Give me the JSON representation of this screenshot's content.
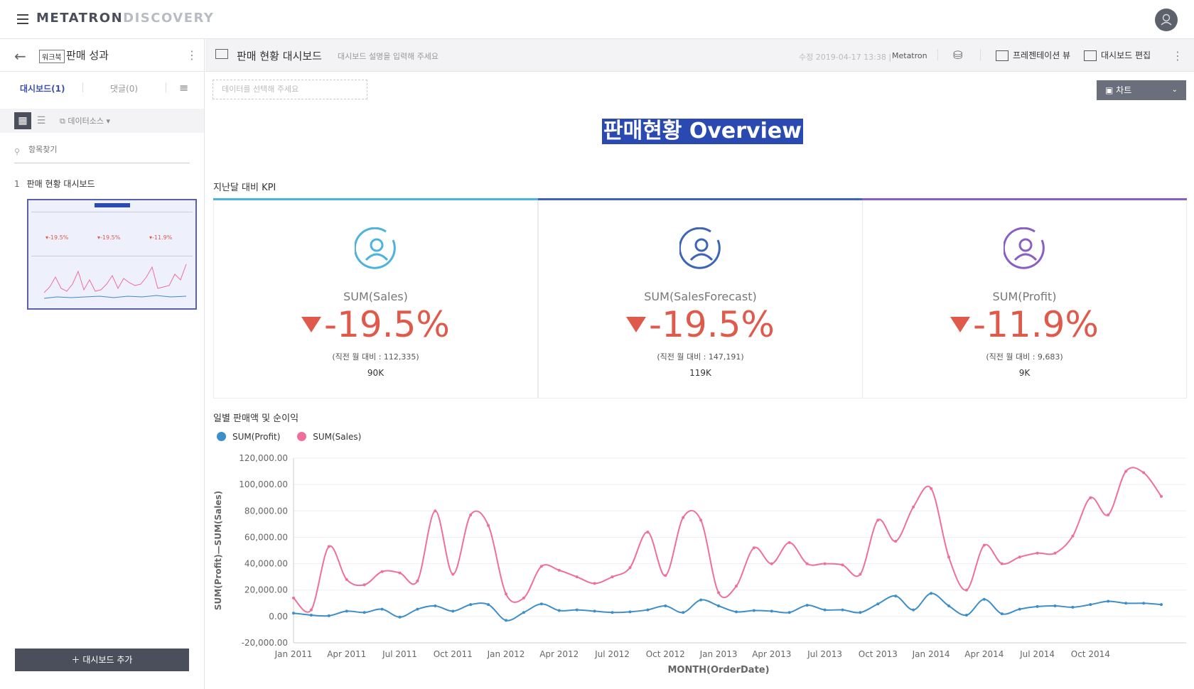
{
  "app": {
    "brand_primary": "METATRON",
    "brand_secondary": "DISCOVERY"
  },
  "sidebar": {
    "workbook_badge": "워크북",
    "workbook_title": "판매 성과",
    "tab_dashboards": "대시보드(1)",
    "tab_comments": "댓글(0)",
    "datasource_label": "데이터소스",
    "search_placeholder": "항목찾기",
    "items": [
      {
        "index": "1",
        "label": "판매 현황 대시보드"
      }
    ],
    "add_button": "대시보드 추가"
  },
  "header": {
    "dashboard_title": "판매 현황 대시보드",
    "description_placeholder": "대시보드 설명을 입력해 주세요",
    "modified": "수정 2019-04-17 13:38 |",
    "modified_by": "Metatron",
    "presentation_label": "프레젠테이션 뷰",
    "edit_label": "대시보드 편집"
  },
  "toolbar": {
    "data_select_placeholder": "데이터를 선택해 주세요",
    "chart_button": "차트"
  },
  "page_title": "판매현황 Overview",
  "kpi_section_label": "지난달 대비 KPI",
  "kpis": [
    {
      "name": "SUM(Sales)",
      "value": "-19.5%",
      "sub": "(직전 월 대비 : 112,335)",
      "abs": "90K",
      "color": "#4db3dc"
    },
    {
      "name": "SUM(SalesForecast)",
      "value": "-19.5%",
      "sub": "(직전 월 대비 : 147,191)",
      "abs": "119K",
      "color": "#3d64b8"
    },
    {
      "name": "SUM(Profit)",
      "value": "-11.9%",
      "sub": "(직전 월 대비 : 9,683)",
      "abs": "9K",
      "color": "#8a5fc4"
    }
  ],
  "chart_section_label": "일별 판매액 및 순이익",
  "chart_data": {
    "type": "line",
    "xlabel": "MONTH(OrderDate)",
    "ylabel": "SUM(Profit)—SUM(Sales)",
    "ylim": [
      -20000,
      120000
    ],
    "yticks": [
      "120,000.00",
      "100,000.00",
      "80,000.00",
      "60,000.00",
      "40,000.00",
      "20,000.00",
      "0.00",
      "-20,000.00"
    ],
    "xticks": [
      "Jan 2011",
      "Apr 2011",
      "Jul 2011",
      "Oct 2011",
      "Jan 2012",
      "Apr 2012",
      "Jul 2012",
      "Oct 2012",
      "Jan 2013",
      "Apr 2013",
      "Jul 2013",
      "Oct 2013",
      "Jan 2014",
      "Apr 2014",
      "Jul 2014",
      "Oct 2014"
    ],
    "legend": "top-left",
    "series": [
      {
        "name": "SUM(Profit)",
        "color": "#3d8ec9",
        "values": [
          2500,
          1000,
          500,
          4000,
          3000,
          5500,
          -500,
          5500,
          8000,
          4000,
          9000,
          9000,
          -3000,
          3000,
          9500,
          4500,
          5000,
          4000,
          3000,
          3500,
          5000,
          8000,
          3000,
          12500,
          8000,
          3500,
          4500,
          4000,
          3000,
          8500,
          5000,
          5000,
          3000,
          9500,
          15500,
          5000,
          17500,
          8000,
          1000,
          13000,
          2000,
          5500,
          7500,
          8000,
          7000,
          9000,
          11500,
          10000,
          10000,
          9000
        ]
      },
      {
        "name": "SUM(Sales)",
        "color": "#f06e9e",
        "values": [
          14000,
          5000,
          53000,
          28000,
          24000,
          34000,
          33000,
          27000,
          80000,
          32000,
          77000,
          69000,
          17000,
          14000,
          38000,
          35000,
          30000,
          25000,
          30000,
          37000,
          64000,
          31000,
          75000,
          73000,
          18000,
          23000,
          52000,
          40000,
          56000,
          40000,
          40000,
          39000,
          32000,
          73000,
          57000,
          83000,
          97000,
          45000,
          20000,
          54000,
          40000,
          45000,
          48000,
          48000,
          61000,
          90000,
          77000,
          110000,
          109000,
          91000
        ]
      }
    ]
  }
}
